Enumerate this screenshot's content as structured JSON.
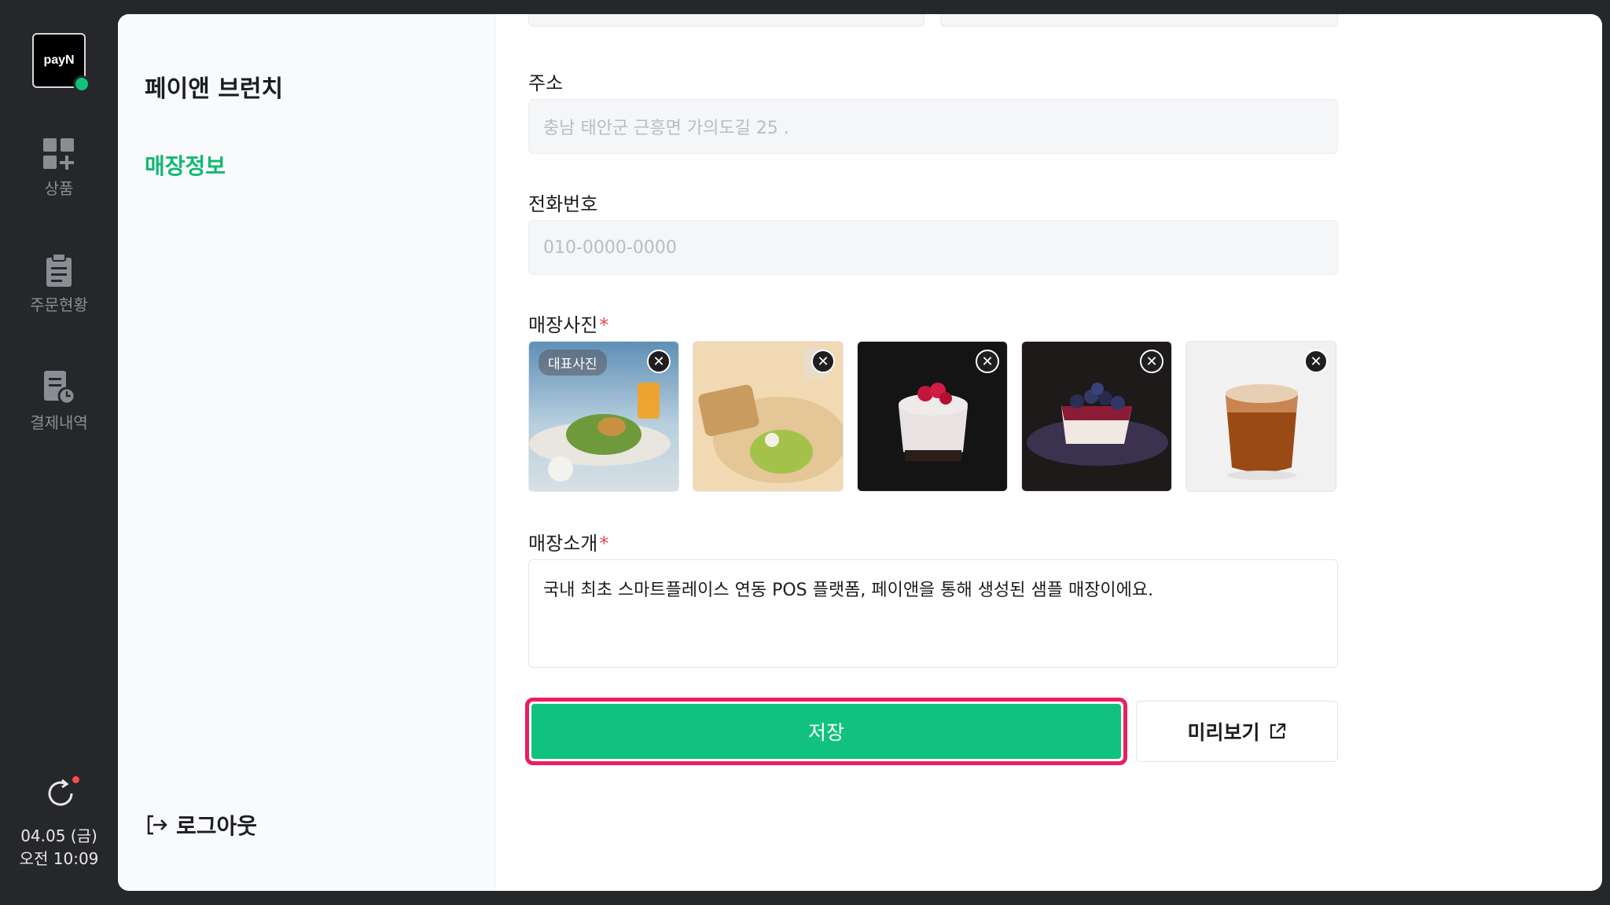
{
  "brand": {
    "logo_text": "payN",
    "accent": "#12c27a"
  },
  "rail": {
    "items": [
      {
        "label": "상품",
        "icon": "grid-plus-icon"
      },
      {
        "label": "주문현황",
        "icon": "clipboard-icon"
      },
      {
        "label": "결제내역",
        "icon": "receipt-clock-icon"
      }
    ],
    "date": "04.05 (금)",
    "time": "오전 10:09"
  },
  "subnav": {
    "store_name": "페이앤 브런치",
    "active_item": "매장정보",
    "logout_label": "로그아웃"
  },
  "form": {
    "address": {
      "label": "주소",
      "placeholder": "충남 태안군 근흥면 가의도길 25 ."
    },
    "phone": {
      "label": "전화번호",
      "placeholder": "010-0000-0000"
    },
    "photos": {
      "label": "매장사진",
      "required_mark": "*",
      "main_badge": "대표사진",
      "items": [
        {
          "desc": "salad-and-juice-photo"
        },
        {
          "desc": "toast-and-salad-photo"
        },
        {
          "desc": "raspberry-cake-photo"
        },
        {
          "desc": "blueberry-cheesecake-photo"
        },
        {
          "desc": "iced-coffee-photo"
        }
      ]
    },
    "intro": {
      "label": "매장소개",
      "required_mark": "*",
      "value": "국내 최초 스마트플레이스 연동 POS 플랫폼, 페이앤을 통해 생성된 샘플 매장이에요."
    },
    "save_label": "저장",
    "preview_label": "미리보기"
  }
}
